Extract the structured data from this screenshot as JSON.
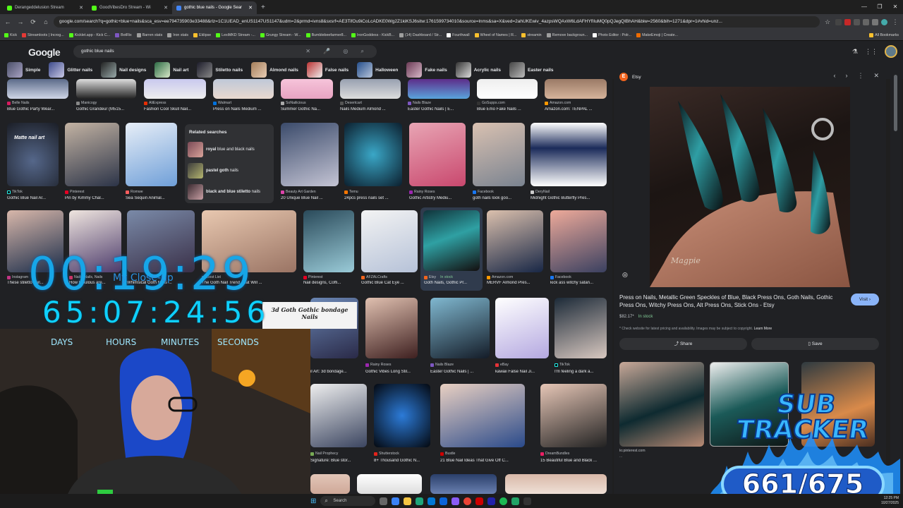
{
  "tabs": [
    {
      "label": "Derangeddelusion Stream",
      "color": "#53fc18",
      "active": false
    },
    {
      "label": "GoodVibesDro Stream - Wi",
      "color": "#53fc18",
      "active": false
    },
    {
      "label": "gothic blue nails - Google Sear",
      "color": "#4285f4",
      "active": true
    }
  ],
  "new_tab": "+",
  "window_controls": [
    "—",
    "❐",
    "✕"
  ],
  "toolbar": {
    "back": "←",
    "forward": "→",
    "reload": "⟳",
    "home": "⌂",
    "url": "google.com/search?q=gothic+blue+nails&sca_esv=ee794735903e33488&rlz=1C1UEAD_enUS1147US1147&udm=2&prmd=ivns8&sxsrf=AE3TifOu9iCoLcADKE0Wg2Z1kiKSJ6sitw:1761599734010&source=lnms&sa=X&ved=2ahUKEwiv_4azpsWQAxW6LdAFHYfIIuMQ0pQJegQIBhAH&biw=2560&bih=1271&dpr=1#vhid=unz...",
    "star": "☆"
  },
  "bookmarks": [
    {
      "label": "Kick",
      "color": "#53fc18"
    },
    {
      "label": "Streamloots | Incrog...",
      "color": "#e53935"
    },
    {
      "label": "Kicklet.app - Kick C...",
      "color": "#53fc18"
    },
    {
      "label": "BotRix",
      "color": "#7e57c2"
    },
    {
      "label": "Barren stats",
      "color": "#9e9e9e"
    },
    {
      "label": "Iron stats",
      "color": "#9e9e9e"
    },
    {
      "label": "Eklipse",
      "color": "#fbc02d"
    },
    {
      "label": "LexiMKD Stream -...",
      "color": "#53fc18"
    },
    {
      "label": "Grungy Stream - W...",
      "color": "#53fc18"
    },
    {
      "label": "Bumblebeefarmer8...",
      "color": "#53fc18"
    },
    {
      "label": "IronGoddess - KickB...",
      "color": "#53fc18"
    },
    {
      "label": "(14) Dashboard / Str...",
      "color": "#9e9e9e"
    },
    {
      "label": "Fourthwall",
      "color": "#ffffff"
    },
    {
      "label": "Wheel of Names | R...",
      "color": "#fbc02d"
    },
    {
      "label": "streamin",
      "color": "#fbc02d"
    },
    {
      "label": "Remove backgroun...",
      "color": "#9e9e9e"
    },
    {
      "label": "Photo Editor : Polr...",
      "color": "#fff"
    },
    {
      "label": "MakeEmoji | Create...",
      "color": "#ef6c00"
    }
  ],
  "all_bookmarks": "All Bookmarks",
  "google": {
    "logo": "Google",
    "query": "gothic blue nails",
    "search_icons": "✕ 🎤 ◎ ⌕"
  },
  "chips": [
    "Simple",
    "Glitter nails",
    "Nail designs",
    "Nail art",
    "Stiletto nails",
    "Almond nails",
    "False nails",
    "Halloween",
    "Fake nails",
    "Acrylic nails",
    "Easter nails"
  ],
  "row0": [
    {
      "src": "Belle Nails",
      "title": "Blue Gothic Party Wear..."
    },
    {
      "src": "Manicogy",
      "title": "Gothic Grandeur (M515..."
    },
    {
      "src": "AliExpress",
      "title": "Fashion Cool Skull Nail..."
    },
    {
      "src": "Walmart",
      "title": "Press on Nails Medium ..."
    },
    {
      "src": "SoNailicious",
      "title": "Summer Gothic Na..."
    },
    {
      "src": "Desertcart",
      "title": "Nails Medium Almond ..."
    },
    {
      "src": "Nails Blaze",
      "title": "Easter Gothic Nails | E..."
    },
    {
      "src": "GoSupps.com",
      "title": "Blue Emo Fake Nails ..."
    },
    {
      "src": "Amazon.com",
      "title": "Amazon.com: TENPAL ..."
    }
  ],
  "row1": [
    {
      "src": "TikTok",
      "title": "Gothic Blue Nail Ar...",
      "overlay": "Matte nail art"
    },
    {
      "src": "Pinterest",
      "title": "Pin by Kimmy Chal..."
    },
    {
      "src": "Romwe",
      "title": "Sea Sequin Animal..."
    },
    {
      "src": "Beauty Art Garden",
      "title": "20 Unique Blue Nail ..."
    },
    {
      "src": "Temu",
      "title": "24pcs press nails set ..."
    },
    {
      "src": "Rainy Roses",
      "title": "Gothic Artistry Mediu..."
    },
    {
      "src": "Facebook",
      "title": "goth nails look goo..."
    },
    {
      "src": "DeryNail",
      "title": "Midnight Gothic Butterfly Pres..."
    }
  ],
  "related": {
    "heading": "Related searches",
    "items": [
      {
        "bold": "royal",
        "rest": " blue and black nails"
      },
      {
        "bold": "pastel goth",
        "rest": " nails"
      },
      {
        "bold": "black and blue stiletto",
        "rest": " nails"
      }
    ]
  },
  "row2": [
    {
      "src": "Instagram",
      "title": "These stiletto nail..."
    },
    {
      "src": "Nails, Nails, Nails",
      "title": "How fabulous are..."
    },
    {
      "src": "",
      "title": "Whimsical Goth Nails ..."
    },
    {
      "src": "Best List",
      "title": "The Goth Nail Trend That Will ..."
    },
    {
      "src": "Pinterest",
      "title": "Nail designs, Coffi..."
    },
    {
      "src": "AFZALCrafts",
      "title": "Gothic Blue Cat Eye ..."
    },
    {
      "src": "Etsy",
      "title": "Goth Nails, Gothic Pr...",
      "stock": "In stock"
    },
    {
      "src": "Amazon.com",
      "title": "MERVF Almond Pres..."
    },
    {
      "src": "Facebook",
      "title": "kick ass witchy satan..."
    }
  ],
  "row3": [
    {
      "src": "",
      "title": "il Art: 3d bondage..."
    },
    {
      "src": "Rainy Roses",
      "title": "Gothic Vibes Long Stil..."
    },
    {
      "src": "Nails Blaze",
      "title": "Easter Gothic Nails | ..."
    },
    {
      "src": "eBay",
      "title": "kawaii False Nail Ji..."
    },
    {
      "src": "TikTok",
      "title": "I'm feeling a dark a..."
    }
  ],
  "row4": [
    {
      "src": "Nail Prophecy",
      "title": "Signature: Blue stor..."
    },
    {
      "src": "Shutterstock",
      "title": "8+ Thousand Gothic N..."
    },
    {
      "src": "Bustle",
      "title": "21 Blue Nail Ideas That Give Off C..."
    },
    {
      "src": "DreamBundles",
      "title": "15 Beautiful Blue and Black ..."
    }
  ],
  "goth_label": "3d Goth Gothic bondage Nails",
  "panel": {
    "source": "Etsy",
    "nav": [
      "‹",
      "›",
      "⋮",
      "✕"
    ],
    "title": "Press on Nails, Metallic Green Speckles of Blue, Black Press Ons, Goth Nails, Gothic Press Ons, Witchy Press Ons, Alt Press Ons, Stick Ons - Etsy",
    "visit": "Visit ›",
    "price": "$82.17*",
    "stock": "In stock",
    "disclaimer": "* Check website for latest pricing and availability. Images may be subject to copyright.",
    "learn_more": "Learn More",
    "share": "Share",
    "save": "Save",
    "watermark": "Magpie",
    "sim_source": "kr.pinterest.com",
    "sim_sub": "...",
    "lens": "◎"
  },
  "overlays": {
    "countdown": "00:19:29",
    "timer": "65:07:24:56",
    "labels": [
      "DAYS",
      "HOURS",
      "MINUTES",
      "SECONDS"
    ],
    "myspace": "My Close-up",
    "sub_title": "SUB TRACKER",
    "sub_count": "661/675"
  },
  "taskbar": {
    "search": "Search",
    "clock": [
      "12:25 PM",
      "10/27/2025"
    ]
  }
}
